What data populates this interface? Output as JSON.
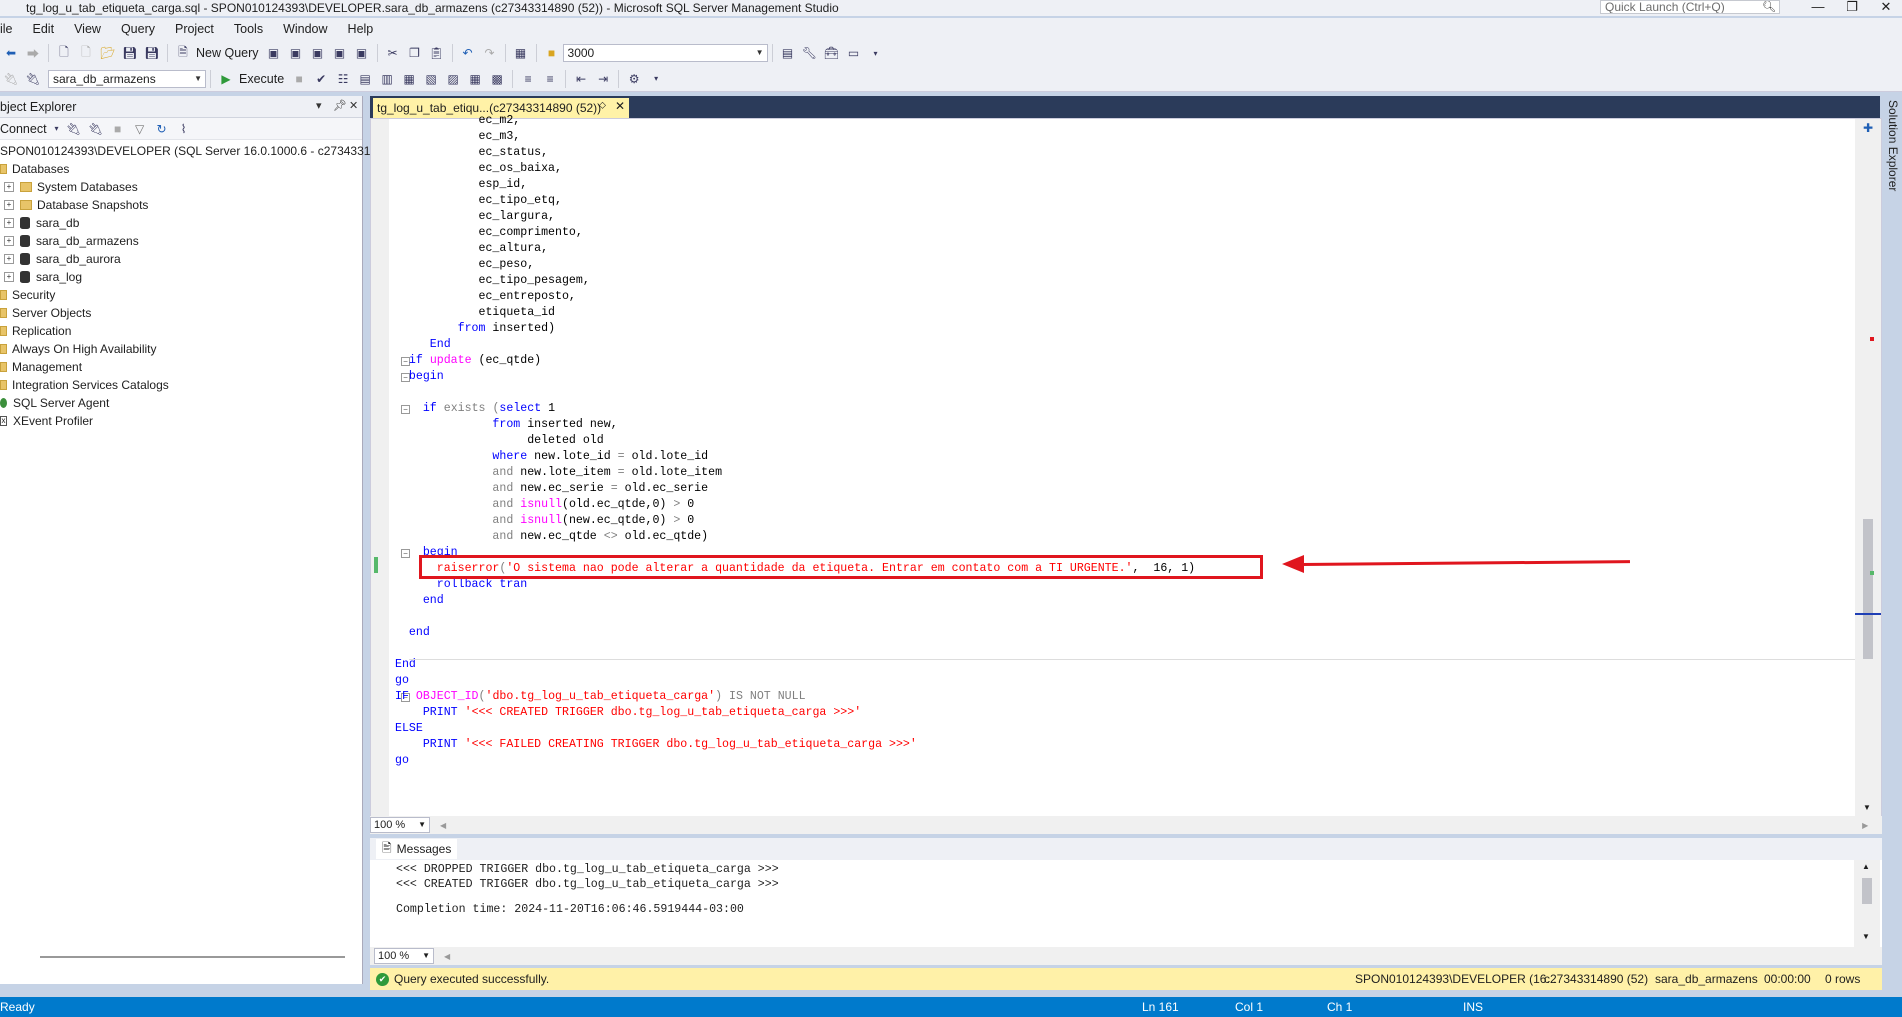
{
  "window": {
    "title": "tg_log_u_tab_etiqueta_carga.sql - SPON010124393\\DEVELOPER.sara_db_armazens (c27343314890 (52)) - Microsoft SQL Server Management Studio",
    "quick_launch_placeholder": "Quick Launch (Ctrl+Q)"
  },
  "menu": [
    "ile",
    "Edit",
    "View",
    "Query",
    "Project",
    "Tools",
    "Window",
    "Help"
  ],
  "toolbar": {
    "new_query_label": "New Query",
    "max_rows": "3000",
    "database": "sara_db_armazens",
    "execute_label": "Execute"
  },
  "object_explorer": {
    "title": "bject Explorer",
    "connect_label": "Connect",
    "server": "SPON010124393\\DEVELOPER (SQL Server 16.0.1000.6 - c27343314890)",
    "nodes": [
      {
        "label": "Databases",
        "icon": "folder-icon",
        "level": 0
      },
      {
        "label": "System Databases",
        "icon": "folder-icon",
        "level": 1
      },
      {
        "label": "Database Snapshots",
        "icon": "folder-icon",
        "level": 1
      },
      {
        "label": "sara_db",
        "icon": "database-icon",
        "level": 1
      },
      {
        "label": "sara_db_armazens",
        "icon": "database-icon",
        "level": 1
      },
      {
        "label": "sara_db_aurora",
        "icon": "database-icon",
        "level": 1
      },
      {
        "label": "sara_log",
        "icon": "database-icon",
        "level": 1
      },
      {
        "label": "Security",
        "icon": "folder-icon",
        "level": 0
      },
      {
        "label": "Server Objects",
        "icon": "folder-icon",
        "level": 0
      },
      {
        "label": "Replication",
        "icon": "folder-icon",
        "level": 0
      },
      {
        "label": "Always On High Availability",
        "icon": "folder-icon",
        "level": 0
      },
      {
        "label": "Management",
        "icon": "folder-icon",
        "level": 0
      },
      {
        "label": "Integration Services Catalogs",
        "icon": "folder-icon",
        "level": 0
      },
      {
        "label": "SQL Server Agent",
        "icon": "agent-icon",
        "level": 0
      },
      {
        "label": "XEvent Profiler",
        "icon": "xevent-icon",
        "level": 0
      }
    ]
  },
  "editor": {
    "tab_label": "tg_log_u_tab_etiqu...(c27343314890 (52))",
    "zoom": "100 %",
    "lines": [
      [
        [
          "            ec_m2,",
          ""
        ]
      ],
      [
        [
          "            ec_m3,",
          ""
        ]
      ],
      [
        [
          "            ec_status,",
          ""
        ]
      ],
      [
        [
          "            ec_os_baixa,",
          ""
        ]
      ],
      [
        [
          "            esp_id,",
          ""
        ]
      ],
      [
        [
          "            ec_tipo_etq,",
          ""
        ]
      ],
      [
        [
          "            ec_largura,",
          ""
        ]
      ],
      [
        [
          "            ec_comprimento,",
          ""
        ]
      ],
      [
        [
          "            ec_altura,",
          ""
        ]
      ],
      [
        [
          "            ec_peso,",
          ""
        ]
      ],
      [
        [
          "            ec_tipo_pesagem,",
          ""
        ]
      ],
      [
        [
          "            ec_entreposto,",
          ""
        ]
      ],
      [
        [
          "            etiqueta_id",
          ""
        ]
      ],
      [
        [
          "         ",
          ""
        ],
        [
          "from",
          "kw"
        ],
        [
          " inserted)",
          ""
        ]
      ],
      [
        [
          "     ",
          ""
        ],
        [
          "End",
          "kw"
        ]
      ],
      [
        [
          "  ",
          ""
        ],
        [
          "if",
          "kw"
        ],
        [
          " ",
          ""
        ],
        [
          "update",
          "fn"
        ],
        [
          " (ec_qtde)",
          ""
        ]
      ],
      [
        [
          "  ",
          ""
        ],
        [
          "begin",
          "kw"
        ]
      ],
      [
        [
          "",
          ""
        ]
      ],
      [
        [
          "    ",
          ""
        ],
        [
          "if",
          "kw"
        ],
        [
          " ",
          ""
        ],
        [
          "exists",
          "gr"
        ],
        [
          " (",
          "gr"
        ],
        [
          "select",
          "kw"
        ],
        [
          " 1",
          ""
        ]
      ],
      [
        [
          "              ",
          ""
        ],
        [
          "from",
          "kw"
        ],
        [
          " inserted new,",
          ""
        ]
      ],
      [
        [
          "                   deleted old",
          ""
        ]
      ],
      [
        [
          "              ",
          ""
        ],
        [
          "where",
          "kw"
        ],
        [
          " new.lote_id ",
          ""
        ],
        [
          "=",
          "gr"
        ],
        [
          " old.lote_id",
          ""
        ]
      ],
      [
        [
          "              ",
          ""
        ],
        [
          "and",
          "gr"
        ],
        [
          " new.lote_item ",
          ""
        ],
        [
          "=",
          "gr"
        ],
        [
          " old.lote_item",
          ""
        ]
      ],
      [
        [
          "              ",
          ""
        ],
        [
          "and",
          "gr"
        ],
        [
          " new.ec_serie ",
          ""
        ],
        [
          "=",
          "gr"
        ],
        [
          " old.ec_serie",
          ""
        ]
      ],
      [
        [
          "              ",
          ""
        ],
        [
          "and",
          "gr"
        ],
        [
          " ",
          ""
        ],
        [
          "isnull",
          "fn"
        ],
        [
          "(old.ec_qtde,0) ",
          ""
        ],
        [
          ">",
          "gr"
        ],
        [
          " 0",
          ""
        ]
      ],
      [
        [
          "              ",
          ""
        ],
        [
          "and",
          "gr"
        ],
        [
          " ",
          ""
        ],
        [
          "isnull",
          "fn"
        ],
        [
          "(new.ec_qtde,0) ",
          ""
        ],
        [
          ">",
          "gr"
        ],
        [
          " 0",
          ""
        ]
      ],
      [
        [
          "              ",
          ""
        ],
        [
          "and",
          "gr"
        ],
        [
          " new.ec_qtde ",
          ""
        ],
        [
          "<>",
          "gr"
        ],
        [
          " old.ec_qtde)",
          ""
        ]
      ],
      [
        [
          "    ",
          ""
        ],
        [
          "begin",
          "kw"
        ]
      ],
      [
        [
          "      ",
          ""
        ],
        [
          "raiserror",
          "str"
        ],
        [
          "(",
          "gr"
        ],
        [
          "'O sistema nao pode alterar a quantidade da etiqueta. Entrar em contato com a TI URGENTE.'",
          "str"
        ],
        [
          ",  16, 1)",
          ""
        ]
      ],
      [
        [
          "      ",
          ""
        ],
        [
          "rollback tran",
          "kw"
        ]
      ],
      [
        [
          "    ",
          ""
        ],
        [
          "end",
          "kw"
        ]
      ],
      [
        [
          "",
          ""
        ]
      ],
      [
        [
          "  ",
          ""
        ],
        [
          "end",
          "kw"
        ]
      ],
      [
        [
          "",
          ""
        ]
      ],
      [
        [
          "End",
          "kw"
        ]
      ],
      [
        [
          "go",
          "kw"
        ]
      ],
      [
        [
          "IF",
          "kw"
        ],
        [
          " ",
          ""
        ],
        [
          "OBJECT_ID",
          "fn"
        ],
        [
          "(",
          "gr"
        ],
        [
          "'dbo.tg_log_u_tab_etiqueta_carga'",
          "str"
        ],
        [
          ") ",
          "gr"
        ],
        [
          "IS NOT NULL",
          "gr"
        ]
      ],
      [
        [
          "    ",
          ""
        ],
        [
          "PRINT",
          "kw"
        ],
        [
          " ",
          ""
        ],
        [
          "'<<< CREATED TRIGGER dbo.tg_log_u_tab_etiqueta_carga >>>'",
          "str"
        ]
      ],
      [
        [
          "ELSE",
          "kw"
        ]
      ],
      [
        [
          "    ",
          ""
        ],
        [
          "PRINT",
          "kw"
        ],
        [
          " ",
          ""
        ],
        [
          "'<<< FAILED CREATING TRIGGER dbo.tg_log_u_tab_etiqueta_carga >>>'",
          "str"
        ]
      ],
      [
        [
          "go",
          "kw"
        ]
      ]
    ]
  },
  "messages": {
    "tab_label": "Messages",
    "lines": [
      "<<< DROPPED TRIGGER dbo.tg_log_u_tab_etiqueta_carga >>>",
      "<<< CREATED TRIGGER dbo.tg_log_u_tab_etiqueta_carga >>>",
      "",
      "Completion time: 2024-11-20T16:06:46.5919444-03:00"
    ],
    "zoom": "100 %"
  },
  "query_status": {
    "message": "Query executed successfully.",
    "server": "SPON010124393\\DEVELOPER (16...",
    "login": "c27343314890 (52)",
    "database": "sara_db_armazens",
    "elapsed": "00:00:00",
    "rows": "0 rows"
  },
  "statusbar": {
    "state": "Ready",
    "ln": "Ln 161",
    "col": "Col 1",
    "ch": "Ch 1",
    "mode": "INS"
  },
  "solution_explorer_label": "Solution Explorer",
  "colors": {
    "accent": "#007acc",
    "highlight_box": "#e0161e",
    "tab_active": "#fff2a7",
    "status_yellow": "#fff1a8"
  }
}
